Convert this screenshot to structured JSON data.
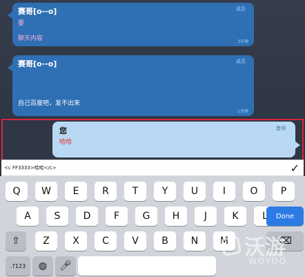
{
  "messages": [
    {
      "nickname": "赛哥[o--o]",
      "role": "成员",
      "lines": [
        "要",
        "聊天内容"
      ],
      "meta": "3分钟"
    },
    {
      "nickname": "赛哥[o--o]",
      "role": "成员",
      "lines": [
        "自己百度吧，发不出来"
      ],
      "meta": "1分钟"
    }
  ],
  "my_message": {
    "nickname": "您",
    "role": "首领",
    "text": "哈哈"
  },
  "composer": {
    "value": "<c FF3333>哈哈</c>",
    "send_icon": "checkmark-icon"
  },
  "keyboard": {
    "row1": [
      "Q",
      "W",
      "E",
      "R",
      "T",
      "Y",
      "U",
      "I",
      "O",
      "P"
    ],
    "row2": [
      "A",
      "S",
      "D",
      "F",
      "G",
      "H",
      "J",
      "K",
      "L"
    ],
    "row3": [
      "Z",
      "X",
      "C",
      "V",
      "B",
      "N",
      "M"
    ],
    "done_label": "Done",
    "numbers_label": ".?123"
  },
  "watermark": {
    "brand_cn": "沃游",
    "brand_en": "WOYOO"
  }
}
